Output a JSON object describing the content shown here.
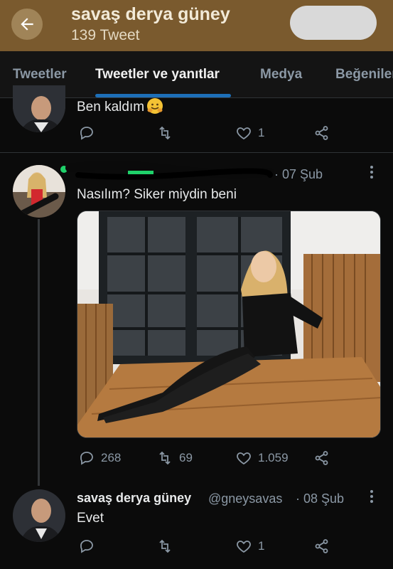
{
  "header": {
    "title": "savaş derya güney",
    "tweet_count": "139 Tweet"
  },
  "tabs": [
    {
      "label": "Tweetler"
    },
    {
      "label": "Tweetler ve yanıtlar"
    },
    {
      "label": "Medya"
    },
    {
      "label": "Beğeniler"
    }
  ],
  "tweets": [
    {
      "text": "Ben kaldım",
      "emoji": "hugging-face-emoji",
      "retweets": "",
      "likes": "1"
    },
    {
      "date": "· 07 Şub",
      "text": "Nasılım? Siker miydin beni",
      "replies": "268",
      "retweets": "69",
      "likes": "1.059"
    },
    {
      "name": "savaş derya güney",
      "handle": "@gneysavas",
      "date": "· 08 Şub",
      "text": "Evet",
      "likes": "1"
    }
  ],
  "colors": {
    "header_bg": "#7a5a2e",
    "tab_accent": "#1d6fb8",
    "background": "#0b0b0b"
  }
}
